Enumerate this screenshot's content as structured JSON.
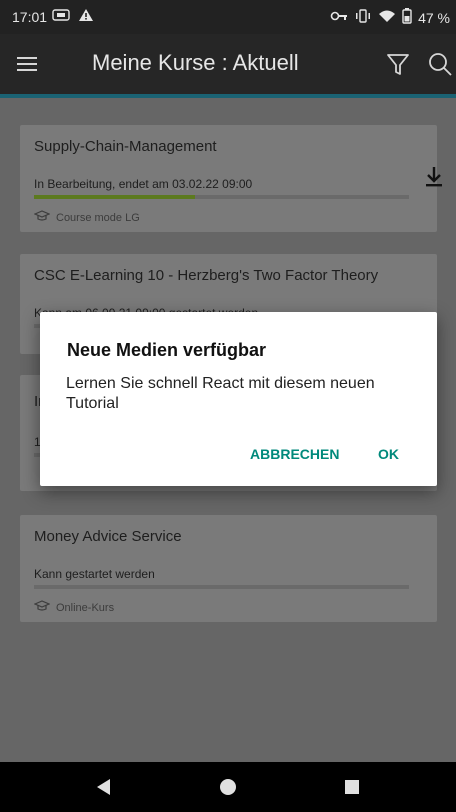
{
  "status_bar": {
    "time": "17:01",
    "battery_percent": "47 %",
    "left_icons": [
      "sim-card-icon",
      "warning-icon"
    ],
    "right_icons": [
      "vpn-key-icon",
      "vibrate-icon",
      "wifi-icon",
      "battery-icon"
    ]
  },
  "app_bar": {
    "title": "Meine Kurse : Aktuell",
    "menu_icon": "menu-icon",
    "filter_icon": "filter-icon",
    "search_icon": "search-icon",
    "accent_color": "#1a6273"
  },
  "courses": [
    {
      "title": "Supply-Chain-Management",
      "status": "In Bearbeitung, endet am 03.02.22 09:00",
      "progress_fraction": 0.43,
      "mode": "Course mode LG",
      "has_download": true
    },
    {
      "title": "CSC E-Learning 10 - Herzberg's Two Factor Theory",
      "status": "Kann am 06.09.21 09:00 gestartet werden",
      "progress_fraction": 0,
      "mode": "",
      "has_download": false
    },
    {
      "title": "In",
      "status": "1",
      "progress_fraction": 0,
      "mode": "",
      "has_download": false
    },
    {
      "title": "Money Advice Service",
      "status": "Kann gestartet werden",
      "progress_fraction": 0,
      "mode": "Online-Kurs",
      "has_download": false
    }
  ],
  "dialog": {
    "title": "Neue Medien verfügbar",
    "message": "Lernen Sie schnell React mit diesem neuen Tutorial",
    "cancel_label": "ABBRECHEN",
    "ok_label": "OK",
    "button_color": "#00897b"
  },
  "nav_bar": {
    "icons": [
      "back-icon",
      "home-icon",
      "recents-icon"
    ]
  },
  "colors": {
    "progress_fill": "#5c7a1f",
    "scrim_background": "#666666"
  }
}
